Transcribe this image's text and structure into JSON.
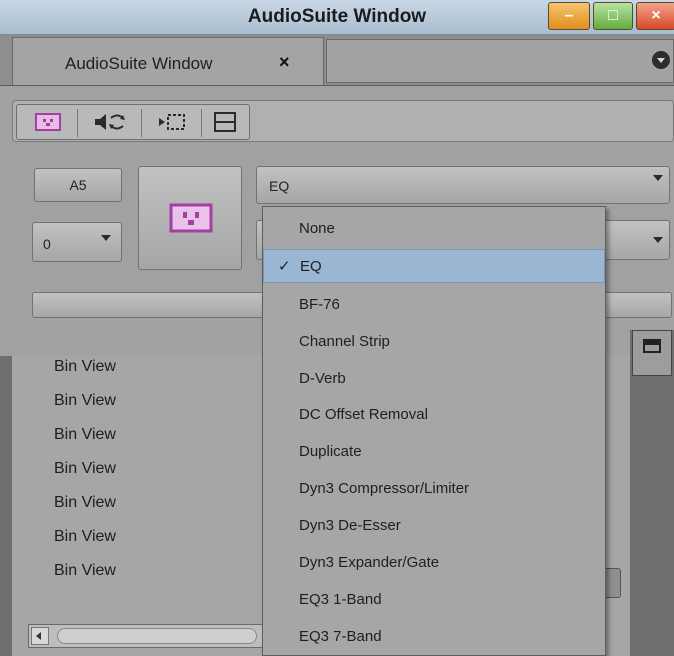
{
  "window": {
    "title": "AudioSuite Window",
    "min_glyph": "–",
    "max_glyph": "□",
    "close_glyph": "×"
  },
  "tab": {
    "label": "AudioSuite Window",
    "close_glyph": "×"
  },
  "toolbar": {
    "icons": [
      "plugin-icon",
      "speaker-loop-icon",
      "play-track-icon",
      "split-view-icon"
    ]
  },
  "controls": {
    "track": "A5",
    "number": "0",
    "plugin_selected": "EQ",
    "second_select": ""
  },
  "dropdown": {
    "items": [
      {
        "label": "None",
        "checked": false
      },
      {
        "label": "EQ",
        "checked": true
      },
      {
        "label": "BF-76",
        "checked": false
      },
      {
        "label": "Channel Strip",
        "checked": false
      },
      {
        "label": "D-Verb",
        "checked": false
      },
      {
        "label": "DC Offset Removal",
        "checked": false
      },
      {
        "label": "Duplicate",
        "checked": false
      },
      {
        "label": "Dyn3 Compressor/Limiter",
        "checked": false
      },
      {
        "label": "Dyn3 De-Esser",
        "checked": false
      },
      {
        "label": "Dyn3 Expander/Gate",
        "checked": false
      },
      {
        "label": "EQ3 1-Band",
        "checked": false
      },
      {
        "label": "EQ3 7-Band",
        "checked": false
      }
    ],
    "check_glyph": "✓"
  },
  "bins": [
    "Bin View",
    "Bin View",
    "Bin View",
    "Bin View",
    "Bin View",
    "Bin View",
    "Bin View"
  ],
  "colors": {
    "accent_purple": "#a43fa4",
    "selection": "#9ab6d3",
    "panel": "#a1a1a1"
  }
}
